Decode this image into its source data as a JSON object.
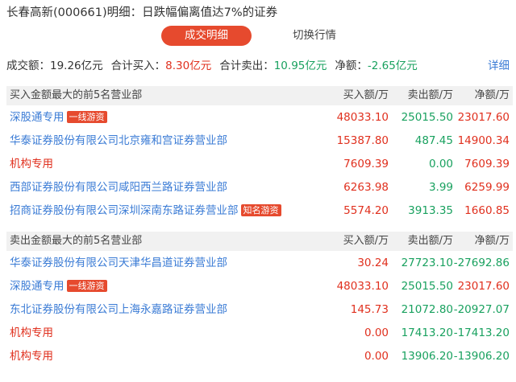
{
  "title": "长春高新(000661)明细：日跌幅偏离值达7%的证券",
  "tabs": {
    "active": "成交明细",
    "other": "切换行情"
  },
  "summary": {
    "turnover_label": "成交额：",
    "turnover_value": "19.26亿元",
    "buy_label": "合计买入：",
    "buy_value": "8.30亿元",
    "sell_label": "合计卖出：",
    "sell_value": "10.95亿元",
    "net_label": "净额：",
    "net_value": "-2.65亿元",
    "detail": "详细"
  },
  "columns": {
    "buy": "买入额/万",
    "sell": "卖出额/万",
    "net": "净额/万"
  },
  "buy_section": {
    "label": "买入金额最大的前5名营业部",
    "rows": [
      {
        "name": "深股通专用",
        "badge": "一线游资",
        "buy": "48033.10",
        "sell": "25015.50",
        "net": "23017.60"
      },
      {
        "name": "华泰证券股份有限公司北京雍和宫证券营业部",
        "badge": "",
        "buy": "15387.80",
        "sell": "487.45",
        "net": "14900.34"
      },
      {
        "name": "机构专用",
        "badge": "",
        "buy": "7609.39",
        "sell": "0.00",
        "net": "7609.39"
      },
      {
        "name": "西部证券股份有限公司咸阳西兰路证券营业部",
        "badge": "",
        "buy": "6263.98",
        "sell": "3.99",
        "net": "6259.99"
      },
      {
        "name": "招商证券股份有限公司深圳深南东路证券营业部",
        "badge": "知名游资",
        "buy": "5574.20",
        "sell": "3913.35",
        "net": "1660.85"
      }
    ]
  },
  "sell_section": {
    "label": "卖出金额最大的前5名营业部",
    "rows": [
      {
        "name": "华泰证券股份有限公司天津华昌道证券营业部",
        "badge": "",
        "buy": "30.24",
        "sell": "27723.10",
        "net": "-27692.86"
      },
      {
        "name": "深股通专用",
        "badge": "一线游资",
        "buy": "48033.10",
        "sell": "25015.50",
        "net": "23017.60"
      },
      {
        "name": "东北证券股份有限公司上海永嘉路证券营业部",
        "badge": "",
        "buy": "145.73",
        "sell": "21072.80",
        "net": "-20927.07"
      },
      {
        "name": "机构专用",
        "badge": "",
        "buy": "0.00",
        "sell": "17413.20",
        "net": "-17413.20"
      },
      {
        "name": "机构专用",
        "badge": "",
        "buy": "0.00",
        "sell": "13906.20",
        "net": "-13906.20"
      }
    ]
  },
  "colors": {
    "accent": "#e64a2e",
    "up": "#e0301e",
    "down": "#19a15f",
    "link": "#3a7bd5"
  }
}
